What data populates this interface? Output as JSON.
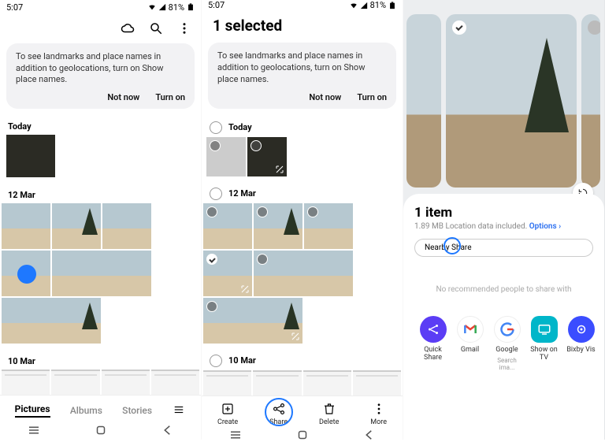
{
  "status": {
    "time": "5:07",
    "battery": "81%"
  },
  "screen1": {
    "cloud_icon": "cloud",
    "search_icon": "search",
    "more_icon": "more",
    "banner": {
      "text": "To see landmarks and place names in addition to geolocations, turn on Show place names.",
      "not_now": "Not now",
      "turn_on": "Turn on"
    },
    "sections": {
      "today": "Today",
      "mar12": "12 Mar",
      "mar10": "10 Mar"
    },
    "tabs": {
      "pictures": "Pictures",
      "albums": "Albums",
      "stories": "Stories"
    }
  },
  "screen2": {
    "title": "1 selected",
    "banner": {
      "text": "To see landmarks and place names in addition to geolocations, turn on Show place names.",
      "not_now": "Not now",
      "turn_on": "Turn on"
    },
    "sections": {
      "today": "Today",
      "mar12": "12 Mar",
      "mar10": "10 Mar"
    },
    "actions": {
      "create": "Create",
      "share": "Share",
      "delete": "Delete",
      "more": "More"
    }
  },
  "screen3": {
    "sheet_title": "1 item",
    "sheet_sub_size": "1.89 MB",
    "sheet_sub_loc": "Location data included.",
    "sheet_sub_options": "Options",
    "nearby": "Nearby Share",
    "rec_text": "No recommended people to share with",
    "apps": {
      "quickshare": "Quick Share",
      "gmail": "Gmail",
      "google": "Google",
      "google_sub": "Search ima...",
      "showontv": "Show on TV",
      "bixby": "Bixby Vis"
    }
  }
}
